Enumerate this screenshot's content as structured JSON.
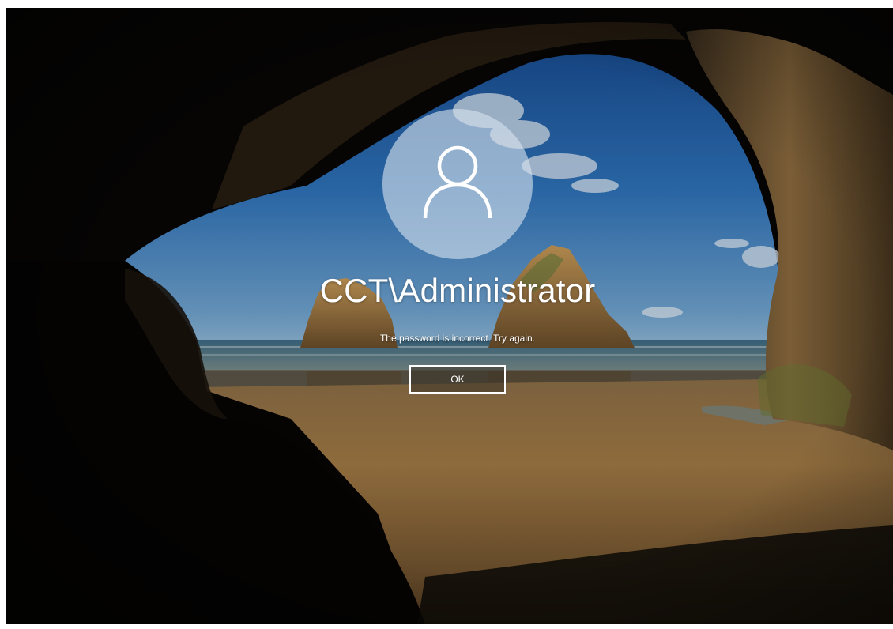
{
  "login": {
    "username": "CCT\\Administrator",
    "message": "The password is incorrect. Try again.",
    "ok_label": "OK"
  },
  "icons": {
    "avatar": "user-avatar-icon"
  },
  "colors": {
    "text": "#ffffff",
    "avatar_bg": "#d6e2ee",
    "sky": "#2e6fb8",
    "sand": "#a2783f",
    "cave": "#050505"
  }
}
